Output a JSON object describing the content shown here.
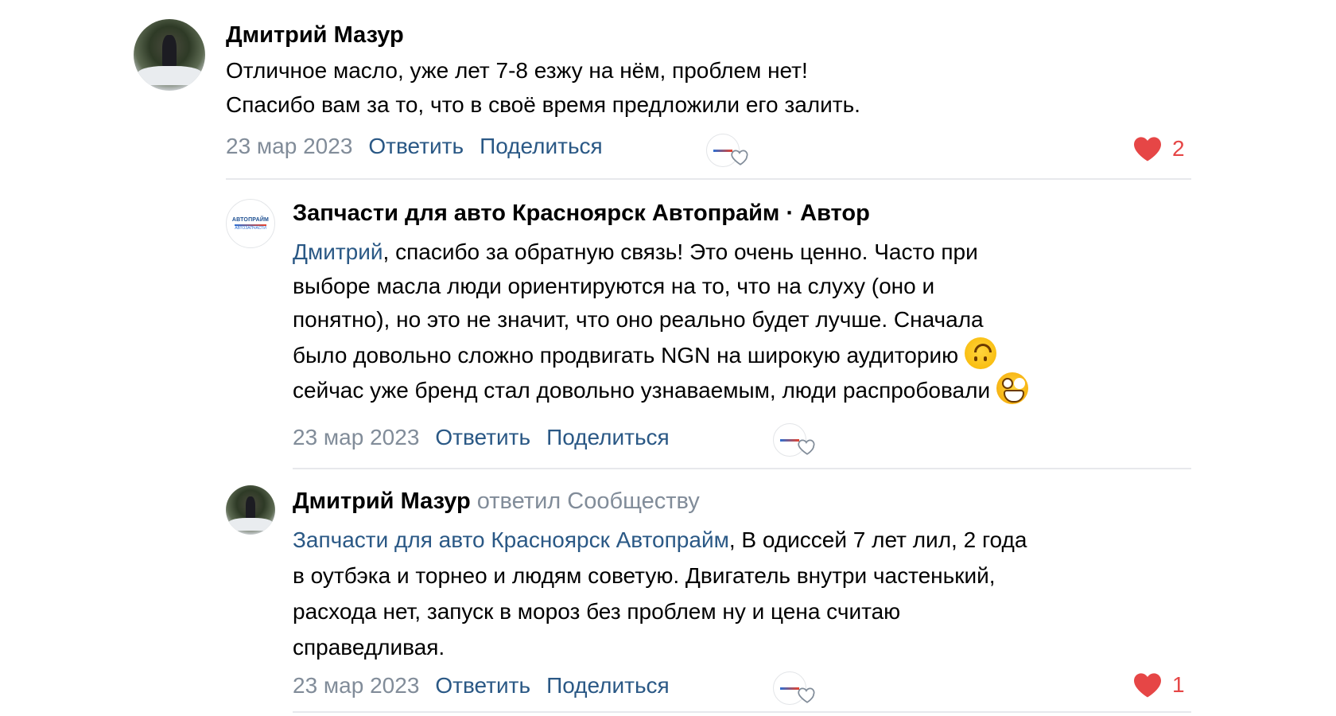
{
  "comments": [
    {
      "author": "Дмитрий Мазур",
      "lines": [
        "Отличное масло, уже лет 7-8 езжу на нём, проблем нет!",
        "Спасибо вам за то, что в своё время предложили его залить."
      ],
      "date": "23 мар 2023",
      "reply_label": "Ответить",
      "share_label": "Поделиться",
      "likes": "2",
      "avatar_icon": "user-photo-avatar"
    },
    {
      "author": "Запчасти для авто Красноярск Автопрайм",
      "author_suffix": " · Автор",
      "logo_text_top": "АВТОПРАЙМ",
      "logo_text_bottom": "АВТОЗАПЧАСТИ",
      "mention": "Дмитрий",
      "lines": [
        ", спасибо за обратную связь! Это очень ценно. Часто при",
        "выборе масла люди ориентируются на то, что на слуху (оно и",
        "понятно), но это не значит, что оно реально будет лучше. Сначала",
        "было довольно сложно продвигать NGN на широкую аудиторию",
        "сейчас уже бренд стал довольно узнаваемым, люди распробовали"
      ],
      "date": "23 мар 2023",
      "reply_label": "Ответить",
      "share_label": "Поделиться",
      "emoji_1": "upside-down-face-emoji",
      "emoji_2": "grinning-face-emoji"
    },
    {
      "author": "Дмитрий Мазур",
      "replied_to": " ответил Сообществу",
      "mention": "Запчасти для авто Красноярск Автопрайм",
      "lines": [
        ", В одиссей 7 лет лил, 2 года",
        "в оутбэка и торнео и людям советую. Двигатель внутри частенький,",
        "расхода нет, запуск в мороз без проблем ну и цена считаю",
        "справедливая."
      ],
      "date": "23 мар 2023",
      "reply_label": "Ответить",
      "share_label": "Поделиться",
      "likes": "1"
    }
  ],
  "colors": {
    "link": "#2a5885",
    "muted": "#818c99",
    "like_red": "#e64646",
    "divider": "#e7e8ec"
  }
}
